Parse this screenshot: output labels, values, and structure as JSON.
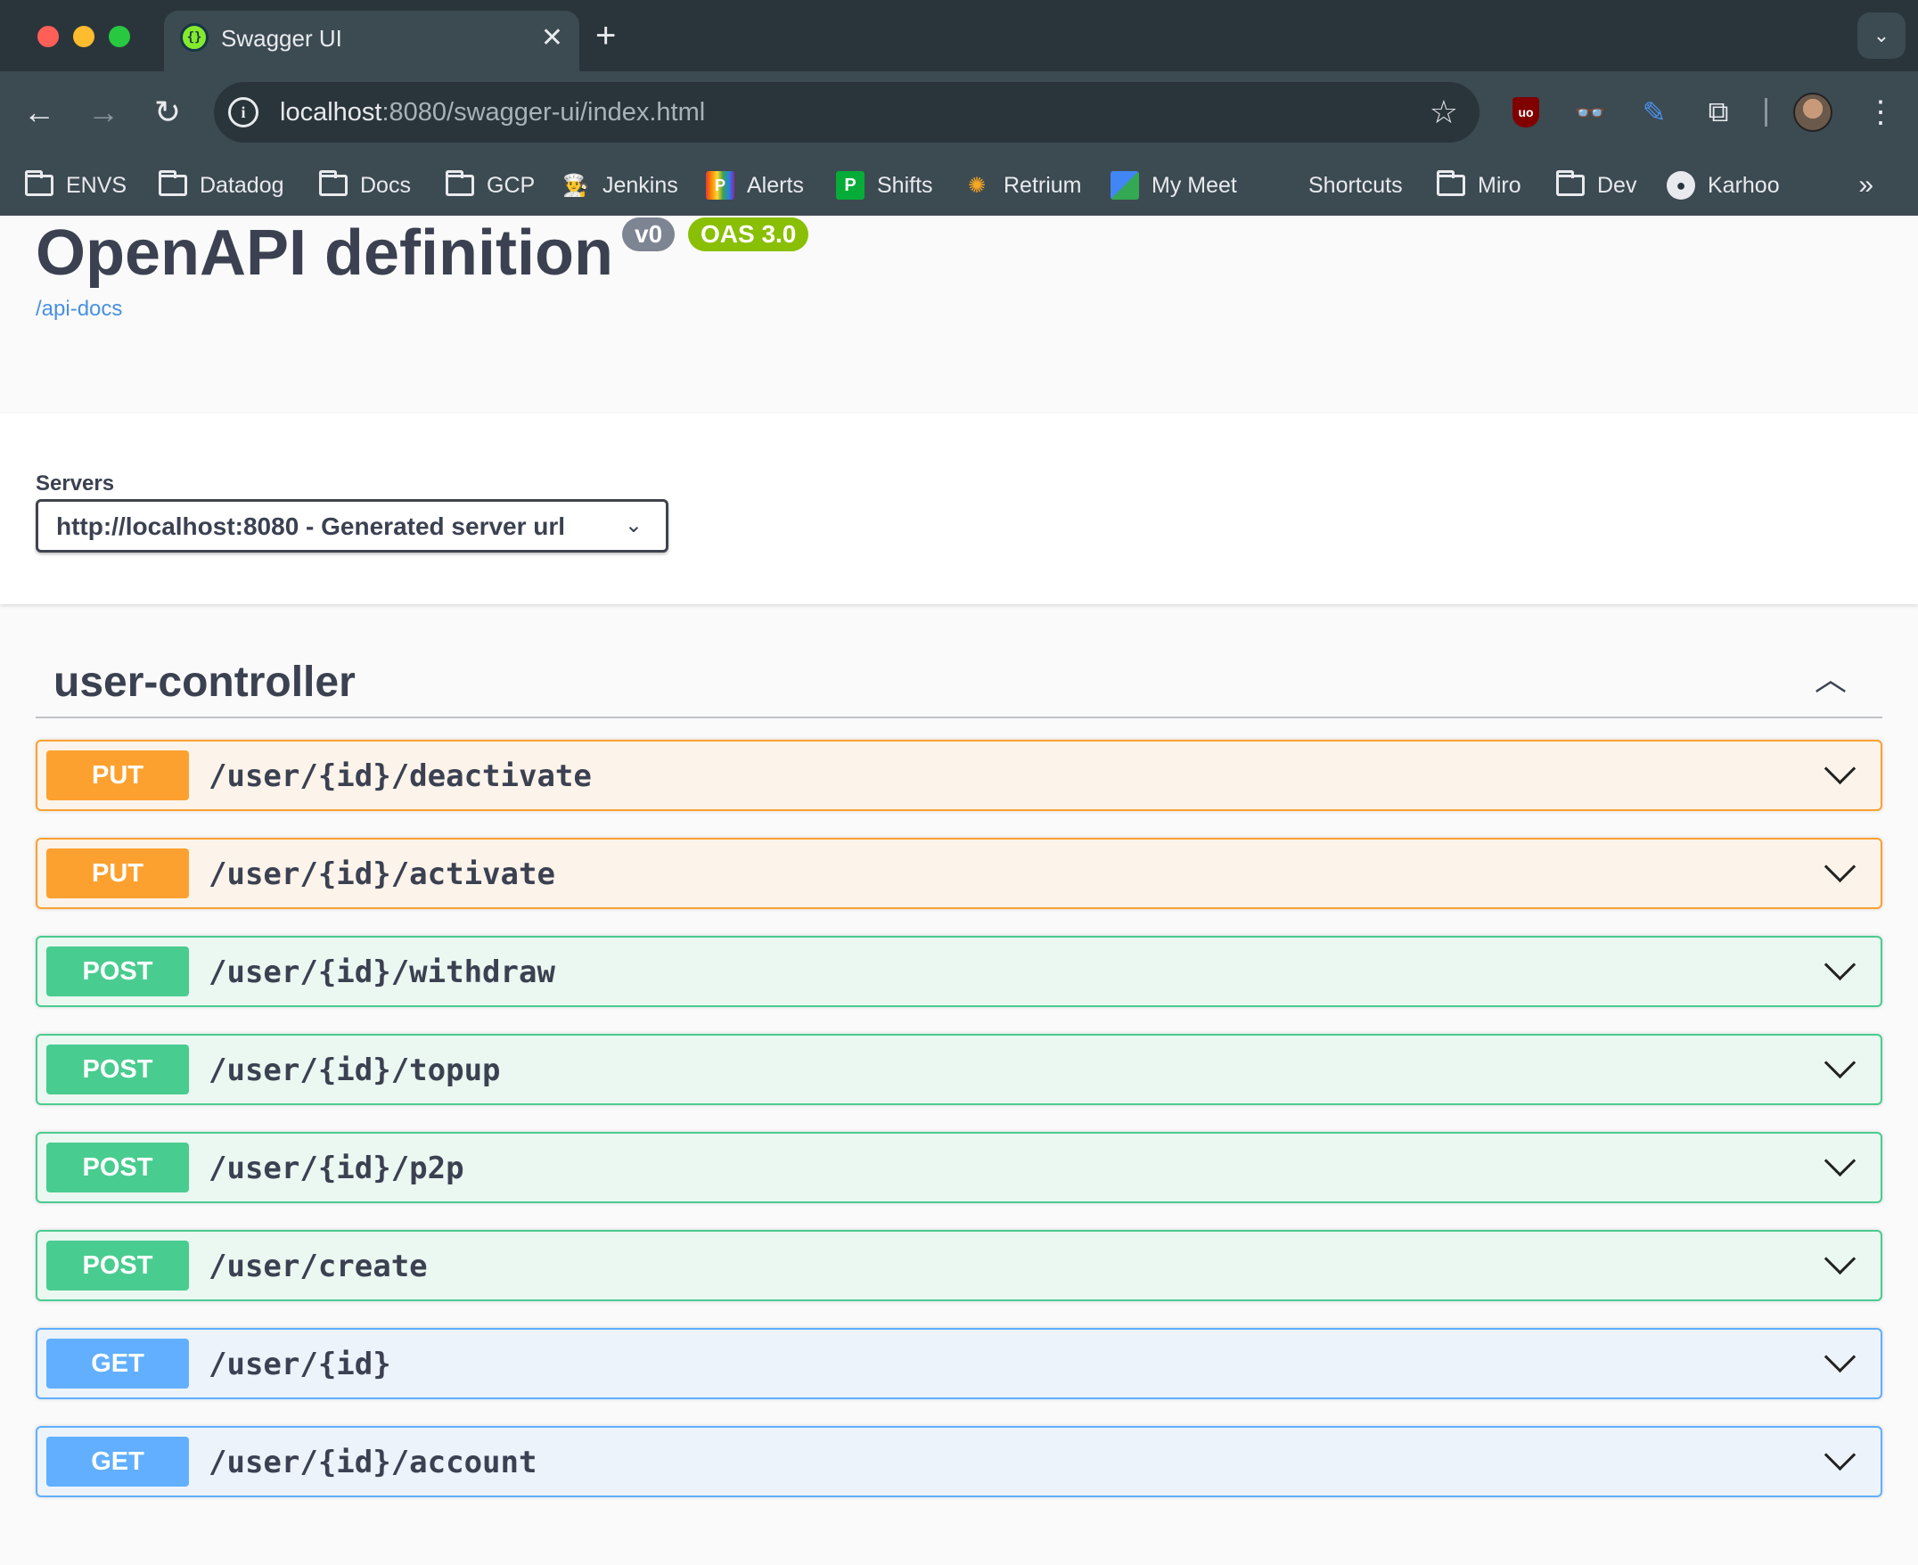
{
  "browser": {
    "tab_title": "Swagger UI",
    "tab_close": "✕",
    "new_tab": "+",
    "url_host": "localhost",
    "url_rest": ":8080/swagger-ui/index.html",
    "bookmarks": [
      {
        "label": "ENVS",
        "icon": "folder-icon"
      },
      {
        "label": "Datadog",
        "icon": "folder-icon"
      },
      {
        "label": "Docs",
        "icon": "folder-icon"
      },
      {
        "label": "GCP",
        "icon": "folder-icon"
      },
      {
        "label": "Jenkins",
        "icon": "jenkins-icon"
      },
      {
        "label": "Alerts",
        "icon": "alerts-icon"
      },
      {
        "label": "Shifts",
        "icon": "shifts-icon"
      },
      {
        "label": "Retrium",
        "icon": "retrium-icon"
      },
      {
        "label": "My Meet",
        "icon": "meet-icon"
      },
      {
        "label": "Shortcuts",
        "icon": "apple-icon"
      },
      {
        "label": "Miro",
        "icon": "folder-icon"
      },
      {
        "label": "Dev",
        "icon": "folder-icon"
      },
      {
        "label": "Karhoo",
        "icon": "github-icon"
      }
    ]
  },
  "info": {
    "title": "OpenAPI definition",
    "version": "v0",
    "oas": "OAS 3.0",
    "api_docs_link": "/api-docs"
  },
  "servers": {
    "label": "Servers",
    "selected": "http://localhost:8080 - Generated server url"
  },
  "tag": {
    "name": "user-controller"
  },
  "operations": [
    {
      "method": "PUT",
      "path": "/user/{id}/deactivate"
    },
    {
      "method": "PUT",
      "path": "/user/{id}/activate"
    },
    {
      "method": "POST",
      "path": "/user/{id}/withdraw"
    },
    {
      "method": "POST",
      "path": "/user/{id}/topup"
    },
    {
      "method": "POST",
      "path": "/user/{id}/p2p"
    },
    {
      "method": "POST",
      "path": "/user/create"
    },
    {
      "method": "GET",
      "path": "/user/{id}"
    },
    {
      "method": "GET",
      "path": "/user/{id}/account"
    }
  ],
  "colors": {
    "put": "#fca130",
    "post": "#49cc90",
    "get": "#61affe",
    "text": "#3b4151",
    "link": "#4990e2",
    "oas_badge": "#89bf04",
    "version_badge": "#7d8492"
  }
}
